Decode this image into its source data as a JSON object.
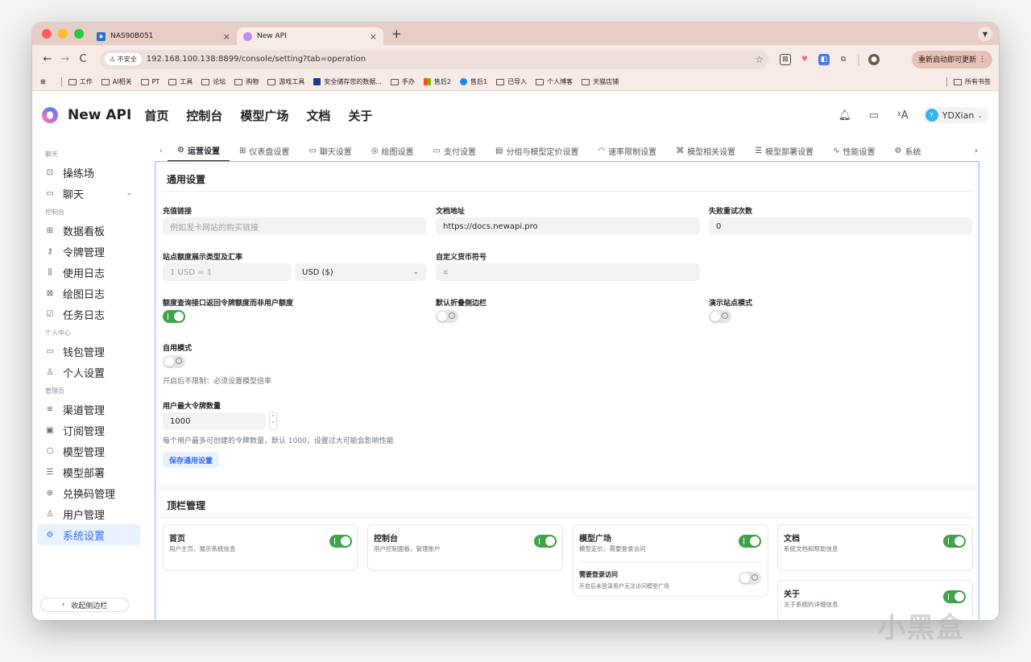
{
  "browser": {
    "tabs": [
      {
        "title": "NAS90B051",
        "close": "×"
      },
      {
        "title": "New API",
        "close": "×"
      }
    ],
    "new_tab": "+",
    "url_warning": "不安全",
    "url": "192.168.100.138:8899/console/setting?tab=operation",
    "relaunch": "重新启动即可更新",
    "bookmarks": [
      "工作",
      "AI相关",
      "PT",
      "工具",
      "论坛",
      "购物",
      "游戏工具",
      "安全储存您的数据...",
      "手办",
      "售后2",
      "售后1",
      "已导入",
      "个人博客",
      "天猫店铺"
    ],
    "all_bookmarks": "所有书签"
  },
  "header": {
    "brand": "New API",
    "nav": [
      "首页",
      "控制台",
      "模型广场",
      "文档",
      "关于"
    ],
    "user": "YDXian",
    "avatar_letter": "Y"
  },
  "sidebar": {
    "groups": [
      {
        "label": "聊天",
        "items": [
          {
            "label": "操练场",
            "icon": "playground-icon"
          },
          {
            "label": "聊天",
            "icon": "chat-icon"
          }
        ]
      },
      {
        "label": "控制台",
        "items": [
          {
            "label": "数据看板"
          },
          {
            "label": "令牌管理"
          },
          {
            "label": "使用日志"
          },
          {
            "label": "绘图日志"
          },
          {
            "label": "任务日志"
          }
        ]
      },
      {
        "label": "个人中心",
        "items": [
          {
            "label": "钱包管理"
          },
          {
            "label": "个人设置"
          }
        ]
      },
      {
        "label": "管理员",
        "items": [
          {
            "label": "渠道管理"
          },
          {
            "label": "订阅管理"
          },
          {
            "label": "模型管理"
          },
          {
            "label": "模型部署"
          },
          {
            "label": "兑换码管理"
          },
          {
            "label": "用户管理"
          },
          {
            "label": "系统设置"
          }
        ]
      }
    ],
    "collapse": "收起侧边栏"
  },
  "settings_tabs": [
    "运营设置",
    "仪表盘设置",
    "聊天设置",
    "绘图设置",
    "支付设置",
    "分组与模型定价设置",
    "速率限制设置",
    "模型相关设置",
    "模型部署设置",
    "性能设置",
    "系统"
  ],
  "general": {
    "title": "通用设置",
    "recharge_label": "充值链接",
    "recharge_placeholder": "例如发卡网站的购买链接",
    "docs_label": "文档地址",
    "docs_value": "https://docs.newapi.pro",
    "retry_label": "失败重试次数",
    "retry_value": "0",
    "quota_label": "站点额度展示类型及汇率",
    "quota_placeholder": "1 USD = 1",
    "currency_value": "USD ($)",
    "symbol_label": "自定义货币符号",
    "symbol_placeholder": "¤",
    "token_quota_label": "额度查询接口返回令牌额度而非用户额度",
    "sidebar_collapse_label": "默认折叠侧边栏",
    "demo_label": "演示站点模式",
    "selfuse_label": "自用模式",
    "selfuse_help": "开启后不限制：必须设置模型倍率",
    "max_tokens_label": "用户最大令牌数量",
    "max_tokens_value": "1000",
    "max_tokens_help": "每个用户最多可创建的令牌数量，默认 1000，设置过大可能会影响性能",
    "save": "保存通用设置"
  },
  "topbar": {
    "title": "顶栏管理",
    "cards": [
      {
        "title": "首页",
        "desc": "用户主页，展示系统信息",
        "on": true
      },
      {
        "title": "控制台",
        "desc": "用户控制面板，管理账户",
        "on": true
      },
      {
        "title": "模型广场",
        "desc": "模型定价，需要登录访问",
        "on": true
      },
      {
        "title": "文档",
        "desc": "系统文档和帮助信息",
        "on": true
      },
      {
        "title": "关于",
        "desc": "关于系统的详细信息",
        "on": true
      }
    ],
    "login_required": {
      "title": "需要登录访问",
      "desc": "开启后未登录用户无法访问模型广场",
      "on": false
    }
  },
  "watermark": "小黑盒"
}
